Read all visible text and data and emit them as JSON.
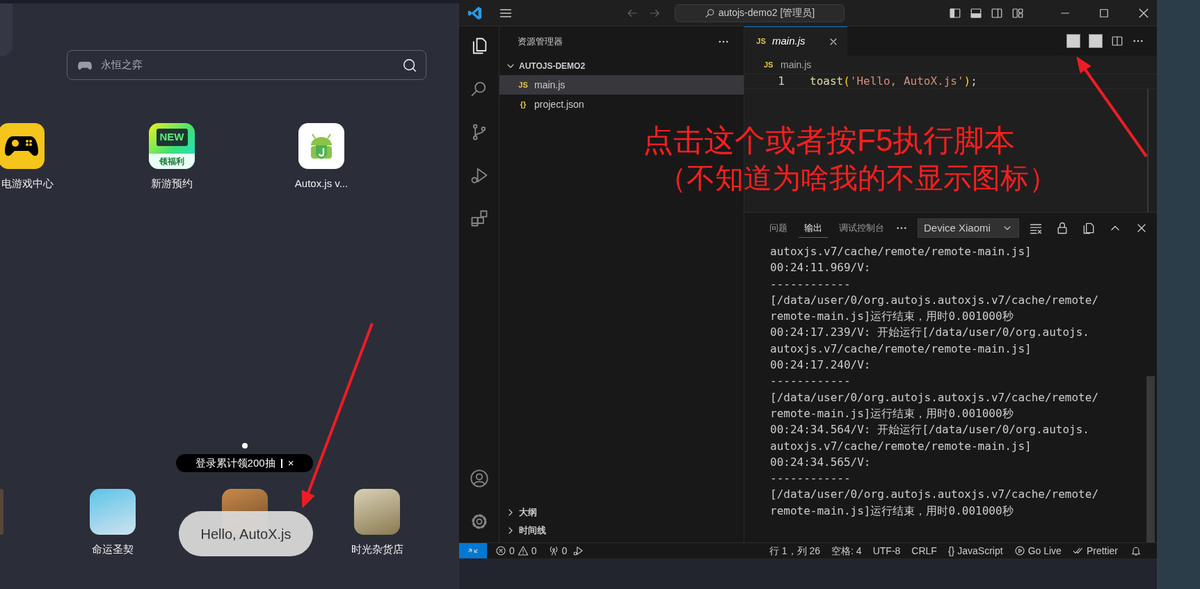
{
  "phone": {
    "search": {
      "placeholder": "永恒之弈"
    },
    "apps_row_1": [
      {
        "label": "电游戏中心",
        "kind": "controller"
      },
      {
        "label": "新游预约",
        "kind": "new",
        "icon_texts": [
          "NEW",
          "领福利"
        ]
      },
      {
        "label": "Autox.js v...",
        "kind": "android"
      }
    ],
    "apps_row_2": [
      {
        "kind": "partial"
      },
      {
        "label": "命运圣契",
        "kind": "photo"
      },
      {
        "kind": "photo"
      },
      {
        "label": "时光杂货店",
        "kind": "photo"
      }
    ],
    "tooltip": {
      "text": "登录累计领200抽",
      "close": "×"
    },
    "toast": {
      "text": "Hello, AutoX.js"
    }
  },
  "vscode": {
    "command_center": "autojs-demo2 [管理员]",
    "sidebar": {
      "title": "资源管理器",
      "folder": "AUTOJS-DEMO2",
      "files": [
        {
          "name": "main.js",
          "icon_text": "JS",
          "selected": true
        },
        {
          "name": "project.json",
          "icon_text": "{}",
          "selected": false
        }
      ],
      "sections": [
        "大纲",
        "时间线"
      ]
    },
    "tabs": [
      {
        "label": "main.js",
        "icon_text": "JS",
        "selected": true
      }
    ],
    "breadcrumb": {
      "icon_text": "JS",
      "label": "main.js"
    },
    "code": [
      {
        "number": "1",
        "tokens": [
          {
            "text": "toast",
            "kind": "function"
          },
          {
            "text": "(",
            "kind": "bracket"
          },
          {
            "text": "'Hello, AutoX.js'",
            "kind": "string"
          },
          {
            "text": ")",
            "kind": "bracket"
          },
          {
            "text": ";",
            "kind": "punct"
          }
        ]
      }
    ],
    "panel": {
      "tabs": [
        {
          "label": "问题",
          "selected": false
        },
        {
          "label": "输出",
          "selected": true
        },
        {
          "label": "调试控制台",
          "selected": false
        }
      ],
      "channel": "Device Xiaomi",
      "output": [
        "autoxjs.v7/cache/remote/remote-main.js]",
        "00:24:11.969/V:",
        "------------",
        "[/data/user/0/org.autojs.autoxjs.v7/cache/remote/",
        "remote-main.js]运行结束，用时0.001000秒",
        "00:24:17.239/V: 开始运行[/data/user/0/org.autojs.",
        "autoxjs.v7/cache/remote/remote-main.js]",
        "00:24:17.240/V:",
        "------------",
        "[/data/user/0/org.autojs.autoxjs.v7/cache/remote/",
        "remote-main.js]运行结束，用时0.001000秒",
        "00:24:34.564/V: 开始运行[/data/user/0/org.autojs.",
        "autoxjs.v7/cache/remote/remote-main.js]",
        "00:24:34.565/V:",
        "------------",
        "[/data/user/0/org.autojs.autoxjs.v7/cache/remote/",
        "remote-main.js]运行结束，用时0.001000秒"
      ]
    },
    "status_bar": {
      "errors": "0",
      "warnings": "0",
      "ports": "0",
      "position": "行 1，列 26",
      "indent": "空格: 4",
      "encoding": "UTF-8",
      "eol": "CRLF",
      "language_icon": "{}",
      "language": "JavaScript",
      "go_live": "Go Live",
      "prettier": "Prettier"
    }
  },
  "annotations": [
    "点击这个或者按F5执行脚本",
    "（不知道为啥我的不显示图标）"
  ]
}
